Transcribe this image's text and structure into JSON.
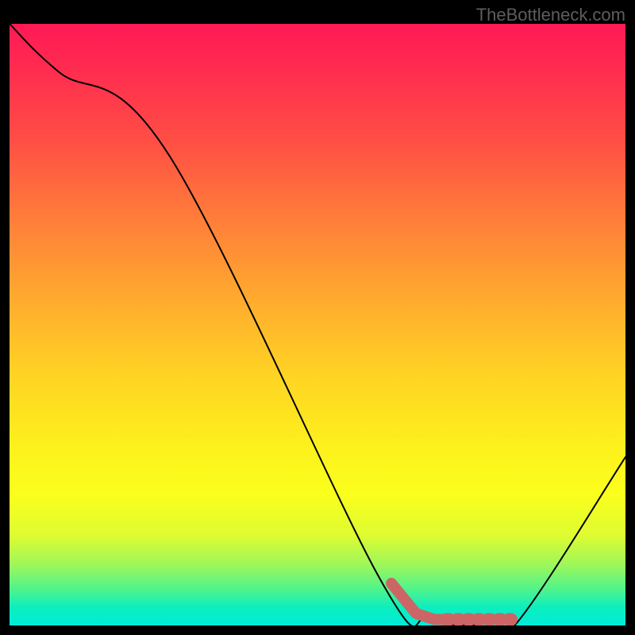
{
  "watermark": "TheBottleneck.com",
  "chart_data": {
    "type": "line",
    "title": "",
    "xlabel": "",
    "ylabel": "",
    "xlim": [
      0,
      100
    ],
    "ylim": [
      0,
      100
    ],
    "series": [
      {
        "name": "curve",
        "x": [
          0,
          8,
          26,
          60,
          68,
          76,
          82,
          100
        ],
        "y": [
          100,
          92,
          78,
          8,
          1,
          0,
          0,
          28
        ]
      }
    ],
    "marks": [
      {
        "name": "blob-stroke",
        "type": "path",
        "color": "#cc6666",
        "x": [
          62,
          66,
          69,
          71,
          75,
          77,
          80,
          82
        ],
        "y": [
          7,
          2,
          1,
          1,
          1,
          1,
          1,
          1
        ]
      }
    ]
  }
}
